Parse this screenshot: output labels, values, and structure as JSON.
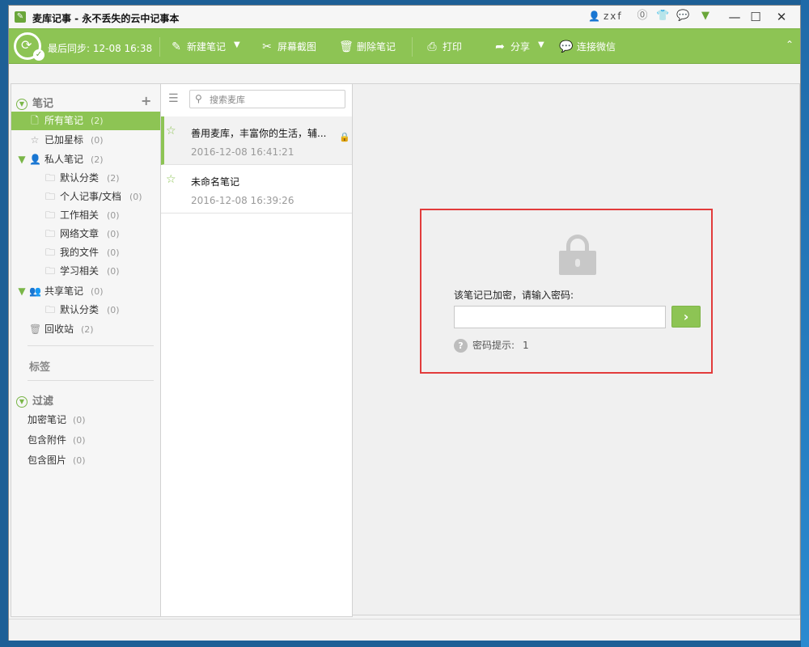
{
  "window": {
    "title": "麦库记事 - 永不丢失的云中记事本",
    "user": "zxf"
  },
  "toolbar": {
    "sync_text": "最后同步: 12-08 16:38",
    "new_note": "新建笔记",
    "screenshot": "屏幕截图",
    "delete_note": "删除笔记",
    "print": "打印",
    "share": "分享",
    "connect_wechat": "连接微信"
  },
  "sidebar": {
    "notes_header": "笔记",
    "items": [
      {
        "label": "所有笔记",
        "count": "(2)"
      },
      {
        "label": "已加星标",
        "count": "(0)"
      },
      {
        "label": "私人笔记",
        "count": "(2)"
      },
      {
        "label": "默认分类",
        "count": "(2)"
      },
      {
        "label": "个人记事/文档",
        "count": "(0)"
      },
      {
        "label": "工作相关",
        "count": "(0)"
      },
      {
        "label": "网络文章",
        "count": "(0)"
      },
      {
        "label": "我的文件",
        "count": "(0)"
      },
      {
        "label": "学习相关",
        "count": "(0)"
      },
      {
        "label": "共享笔记",
        "count": "(0)"
      },
      {
        "label": "默认分类",
        "count": "(0)"
      },
      {
        "label": "回收站",
        "count": "(2)"
      }
    ],
    "tags_header": "标签",
    "filter_header": "过滤",
    "filters": [
      {
        "label": "加密笔记",
        "count": "(0)"
      },
      {
        "label": "包含附件",
        "count": "(0)"
      },
      {
        "label": "包含图片",
        "count": "(0)"
      }
    ]
  },
  "notelist": {
    "search_placeholder": "搜索麦库",
    "notes": [
      {
        "title": "善用麦库，丰富你的生活，辅...",
        "date": "2016-12-08 16:41:21"
      },
      {
        "title": "未命名笔记",
        "date": "2016-12-08 16:39:26"
      }
    ]
  },
  "editor": {
    "encrypted_prompt": "该笔记已加密，请输入密码:",
    "hint_label": "密码提示:",
    "hint_value": "1"
  },
  "colors": {
    "accent": "#8dc454",
    "highlight_border": "#e23b3b"
  }
}
